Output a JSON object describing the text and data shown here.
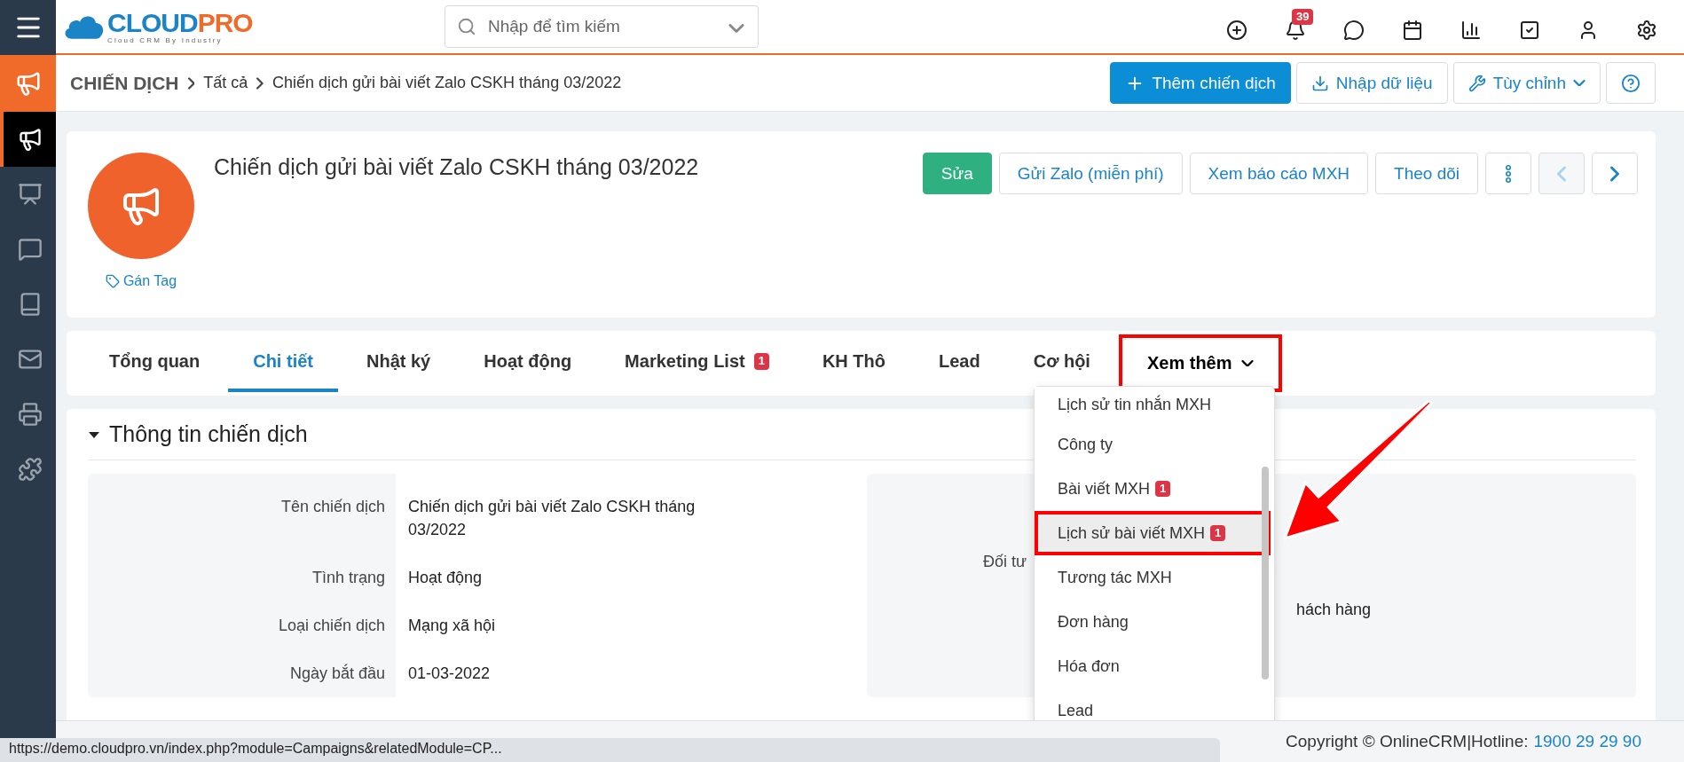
{
  "topbar": {
    "logo": {
      "part1": "CLOUD",
      "part2": "PRO",
      "tagline": "Cloud CRM By Industry"
    },
    "search": {
      "placeholder": "Nhập để tìm kiếm"
    },
    "icons": [
      {
        "kind": "add"
      },
      {
        "kind": "bell",
        "badge": "39"
      },
      {
        "kind": "chat"
      },
      {
        "kind": "calendar"
      },
      {
        "kind": "report"
      },
      {
        "kind": "task"
      },
      {
        "kind": "user"
      },
      {
        "kind": "settings"
      }
    ]
  },
  "sidebar": {
    "items": [
      {
        "kind": "campaign",
        "selected": true
      },
      {
        "kind": "meeting",
        "selected": false
      },
      {
        "kind": "chat",
        "selected": false
      },
      {
        "kind": "book",
        "selected": false
      },
      {
        "kind": "mail",
        "selected": false
      },
      {
        "kind": "fax",
        "selected": false
      },
      {
        "kind": "plugin",
        "selected": false
      }
    ]
  },
  "breadcrumb": {
    "module": "CHIẾN DỊCH",
    "items": [
      "Tất cả",
      "Chiến dịch gửi bài viết Zalo CSKH tháng 03/2022"
    ]
  },
  "page_actions": [
    {
      "kind": "add",
      "label": "Thêm chiến dịch"
    },
    {
      "kind": "import",
      "label": "Nhập dữ liệu"
    },
    {
      "kind": "customize",
      "label": "Tùy chỉnh"
    },
    {
      "kind": "help"
    }
  ],
  "record": {
    "title": "Chiến dịch gửi bài viết Zalo CSKH tháng 03/2022",
    "tag_link": "Gán Tag",
    "actions": [
      {
        "kind": "edit",
        "label": "Sửa"
      },
      {
        "kind": "text",
        "label": "Gửi Zalo (miễn phí)"
      },
      {
        "kind": "text",
        "label": "Xem báo cáo MXH"
      },
      {
        "kind": "text",
        "label": "Theo dõi"
      },
      {
        "kind": "more"
      },
      {
        "kind": "prev",
        "disabled": true
      },
      {
        "kind": "next",
        "disabled": false
      }
    ]
  },
  "tabs": [
    {
      "label": "Tổng quan",
      "selected": false
    },
    {
      "label": "Chi tiết",
      "selected": true
    },
    {
      "label": "Nhật ký",
      "selected": false
    },
    {
      "label": "Hoạt động",
      "selected": false
    },
    {
      "label": "Marketing List",
      "badge": "1",
      "selected": false
    },
    {
      "label": "KH Thô",
      "selected": false
    },
    {
      "label": "Lead",
      "selected": false
    },
    {
      "label": "Cơ hội",
      "selected": false
    },
    {
      "label": "Xem thêm",
      "selected": false,
      "kind": "dropdown",
      "highlighted": true,
      "expanded": true
    }
  ],
  "more_menu": {
    "items": [
      {
        "label": "Lịch sử tin nhắn MXH",
        "highlighted": false
      },
      {
        "label": "Công ty",
        "highlighted": false
      },
      {
        "label": "Bài viết MXH",
        "badge": "1",
        "highlighted": false
      },
      {
        "label": "Lịch sử bài viết MXH",
        "badge": "1",
        "highlighted": true
      },
      {
        "label": "Tương tác MXH",
        "highlighted": false
      },
      {
        "label": "Đơn hàng",
        "highlighted": false
      },
      {
        "label": "Hóa đơn",
        "highlighted": false
      },
      {
        "label": "Lead",
        "highlighted": false
      }
    ]
  },
  "section": {
    "title": "Thông tin chiến dịch",
    "expanded": true,
    "left_fields": [
      {
        "label": "Tên chiến dịch",
        "value": "Chiến dịch gửi bài viết Zalo CSKH tháng 03/2022"
      },
      {
        "label": "Tình trạng",
        "value": "Hoạt động"
      },
      {
        "label": "Loại chiến dịch",
        "value": "Mạng xã hội"
      },
      {
        "label": "Ngày bắt đầu",
        "value": "01-03-2022"
      }
    ],
    "right_fields": [
      {
        "label": "Đối tư"
      },
      {
        "value": "hách hàng"
      }
    ]
  },
  "footer": {
    "copyright": "Copyright © OnlineCRM|Hotline:",
    "hotline": "1900 29 29 90"
  },
  "status_url": "https://demo.cloudpro.vn/index.php?module=Campaigns&relatedModule=CP..."
}
